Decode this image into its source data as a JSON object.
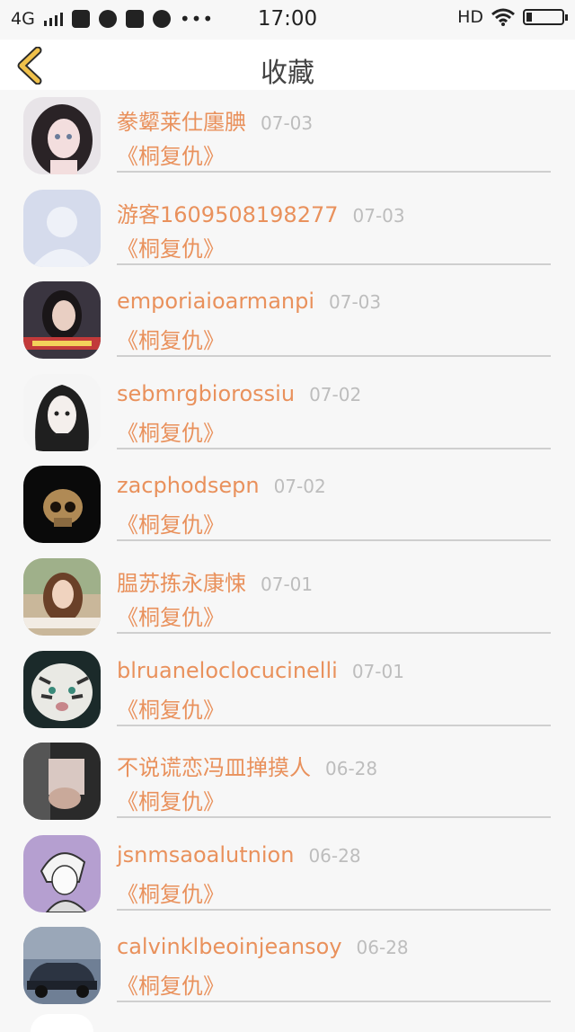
{
  "status_bar": {
    "carrier": "4G",
    "time": "17:00",
    "hd": "HD",
    "dots": "•••"
  },
  "nav": {
    "title": "收藏",
    "back_icon": "chevron-left-icon",
    "accent": "#f0c14b"
  },
  "colors": {
    "name": "#e9915c",
    "date": "#bdbdbd",
    "background": "#f7f7f7"
  },
  "items": [
    {
      "name": "豢颦莱仕廛腆",
      "date": "07-03",
      "title": "《桐复仇》",
      "avatar": "girl-illustration-avatar"
    },
    {
      "name": "游客1609508198277",
      "date": "07-03",
      "title": "《桐复仇》",
      "avatar": "default-person-avatar"
    },
    {
      "name": "emporiaioarmanpi",
      "date": "07-03",
      "title": "《桐复仇》",
      "avatar": "girl-photo-avatar"
    },
    {
      "name": "sebmrgbiorossiu",
      "date": "07-02",
      "title": "《桐复仇》",
      "avatar": "anime-girl-avatar"
    },
    {
      "name": "zacphodsepn",
      "date": "07-02",
      "title": "《桐复仇》",
      "avatar": "skull-avatar"
    },
    {
      "name": "腽苏拣永康悚",
      "date": "07-01",
      "title": "《桐复仇》",
      "avatar": "girl-outdoor-avatar"
    },
    {
      "name": "blruaneloclocucinelli",
      "date": "07-01",
      "title": "《桐复仇》",
      "avatar": "tiger-avatar"
    },
    {
      "name": "不说谎恋冯皿掸摸人",
      "date": "06-28",
      "title": "《桐复仇》",
      "avatar": "hands-photo-avatar"
    },
    {
      "name": "jsnmsaoalutnion",
      "date": "06-28",
      "title": "《桐复仇》",
      "avatar": "anime-boy-avatar"
    },
    {
      "name": "calvinklbeoinjeansoy",
      "date": "06-28",
      "title": "《桐复仇》",
      "avatar": "car-avatar"
    }
  ]
}
